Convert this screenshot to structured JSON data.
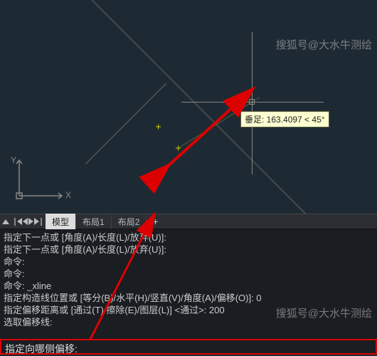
{
  "watermark_top": "搜狐号@大水牛测绘",
  "watermark_bottom": "搜狐号@大水牛测绘",
  "axis": {
    "x": "X",
    "y": "Y"
  },
  "tooltip": {
    "label": "垂足: 163.4097 < 45°"
  },
  "tabs": {
    "model": "模型",
    "layout1": "布局1",
    "layout2": "布局2",
    "add": "+"
  },
  "cmdlog": {
    "l1": "指定下一点或 [角度(A)/长度(L)/放弃(U)]:",
    "l2": "指定下一点或 [角度(A)/长度(L)/放弃(U)]:",
    "l3": "命令:",
    "l4": "命令:",
    "l5": "命令: _xline",
    "l6": "指定构造线位置或  [等分(B)/水平(H)/竖直(V)/角度(A)/偏移(O)]: 0",
    "l7": "指定偏移距离或 [通过(T)/擦除(E)/图层(L)] <通过>: 200",
    "l8": "选取偏移线:"
  },
  "cmdline": "指定向哪侧偏移:"
}
